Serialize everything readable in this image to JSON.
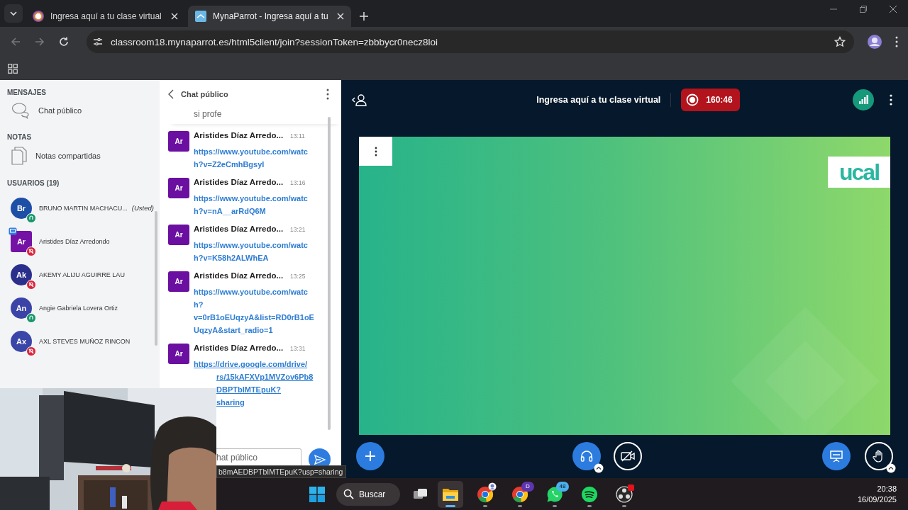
{
  "browser": {
    "tabs": [
      {
        "title": "Ingresa aquí a tu clase virtual",
        "selected": false
      },
      {
        "title": "MynaParrot - Ingresa aquí a tu",
        "selected": true
      }
    ],
    "url": "classroom18.mynaparrot.es/html5client/join?sessionToken=zbbbycr0necz8loi"
  },
  "sidebar": {
    "messages_heading": "MENSAJES",
    "public_chat": "Chat público",
    "notes_heading": "NOTAS",
    "shared_notes": "Notas compartidas",
    "users_heading": "USUARIOS (19)",
    "users": [
      {
        "initials": "Br",
        "name": "BRUNO MARTIN MACHACU...",
        "you_label": "(Usted)",
        "color": "#1e4fa6",
        "moderator": false,
        "presenter": false,
        "muted": false
      },
      {
        "initials": "Ar",
        "name": "Aristides Díaz Arredondo",
        "color": "#7412a6",
        "moderator": true,
        "presenter": true,
        "muted": true
      },
      {
        "initials": "Ak",
        "name": "AKEMY ALIJU AGUIRRE LAU",
        "color": "#2b2f8c",
        "moderator": false,
        "presenter": false,
        "muted": true
      },
      {
        "initials": "An",
        "name": "Angie Gabriela Lovera Ortiz",
        "color": "#3b44a6",
        "moderator": false,
        "presenter": false,
        "muted": false
      },
      {
        "initials": "Ax",
        "name": "AXL STEVES MUÑOZ RINCON",
        "color": "#3a45a8",
        "moderator": false,
        "presenter": false,
        "muted": true
      }
    ]
  },
  "chat": {
    "title": "Chat público",
    "partial_message": "si profe",
    "placeholder": "hat público",
    "messages": [
      {
        "initials": "Ar",
        "sender": "Aristides Díaz Arredo...",
        "time": "13:11",
        "link_lines": [
          "https://www.youtube.com/watc",
          "h?v=Z2eCmhBgsyI"
        ]
      },
      {
        "initials": "Ar",
        "sender": "Aristides Díaz Arredo...",
        "time": "13:16",
        "link_lines": [
          "https://www.youtube.com/watc",
          "h?v=nA__arRdQ6M"
        ]
      },
      {
        "initials": "Ar",
        "sender": "Aristides Díaz Arredo...",
        "time": "13:21",
        "link_lines": [
          "https://www.youtube.com/watc",
          "h?v=K58h2ALWhEA"
        ]
      },
      {
        "initials": "Ar",
        "sender": "Aristides Díaz Arredo...",
        "time": "13:25",
        "link_lines": [
          "https://www.youtube.com/watc",
          "h?",
          "v=0rB1oEUqzyA&list=RD0rB1oE",
          "UqzyA&start_radio=1"
        ]
      },
      {
        "initials": "Ar",
        "sender": "Aristides Díaz Arredo...",
        "time": "13:31",
        "link_lines": [
          "https://drive.google.com/drive/"
        ],
        "covered_lines": [
          "rs/15kAFXVp1MVZov6Pb8",
          "DBPTbIMTEpuK?",
          "sharing"
        ]
      }
    ]
  },
  "meeting": {
    "title": "Ingresa aquí a tu clase virtual",
    "recording": {
      "on": true,
      "time": "160:46"
    },
    "logo": "ucal",
    "audio_joined": true
  },
  "status_tooltip": "b8mAEDBPTbIMTEpuK?usp=sharing",
  "taskbar": {
    "search": "Buscar",
    "apps": [
      {
        "kind": "explorer",
        "selected": true
      },
      {
        "kind": "chrome",
        "selected": false,
        "profile_badge": true
      },
      {
        "kind": "chrome",
        "selected": false,
        "badge": "D"
      },
      {
        "kind": "whatsapp",
        "selected": false,
        "badge": "48"
      },
      {
        "kind": "spotify",
        "selected": false
      },
      {
        "kind": "obs",
        "selected": false,
        "alert_dot": true
      }
    ],
    "time": "20:38",
    "date": "16/09/2025"
  }
}
